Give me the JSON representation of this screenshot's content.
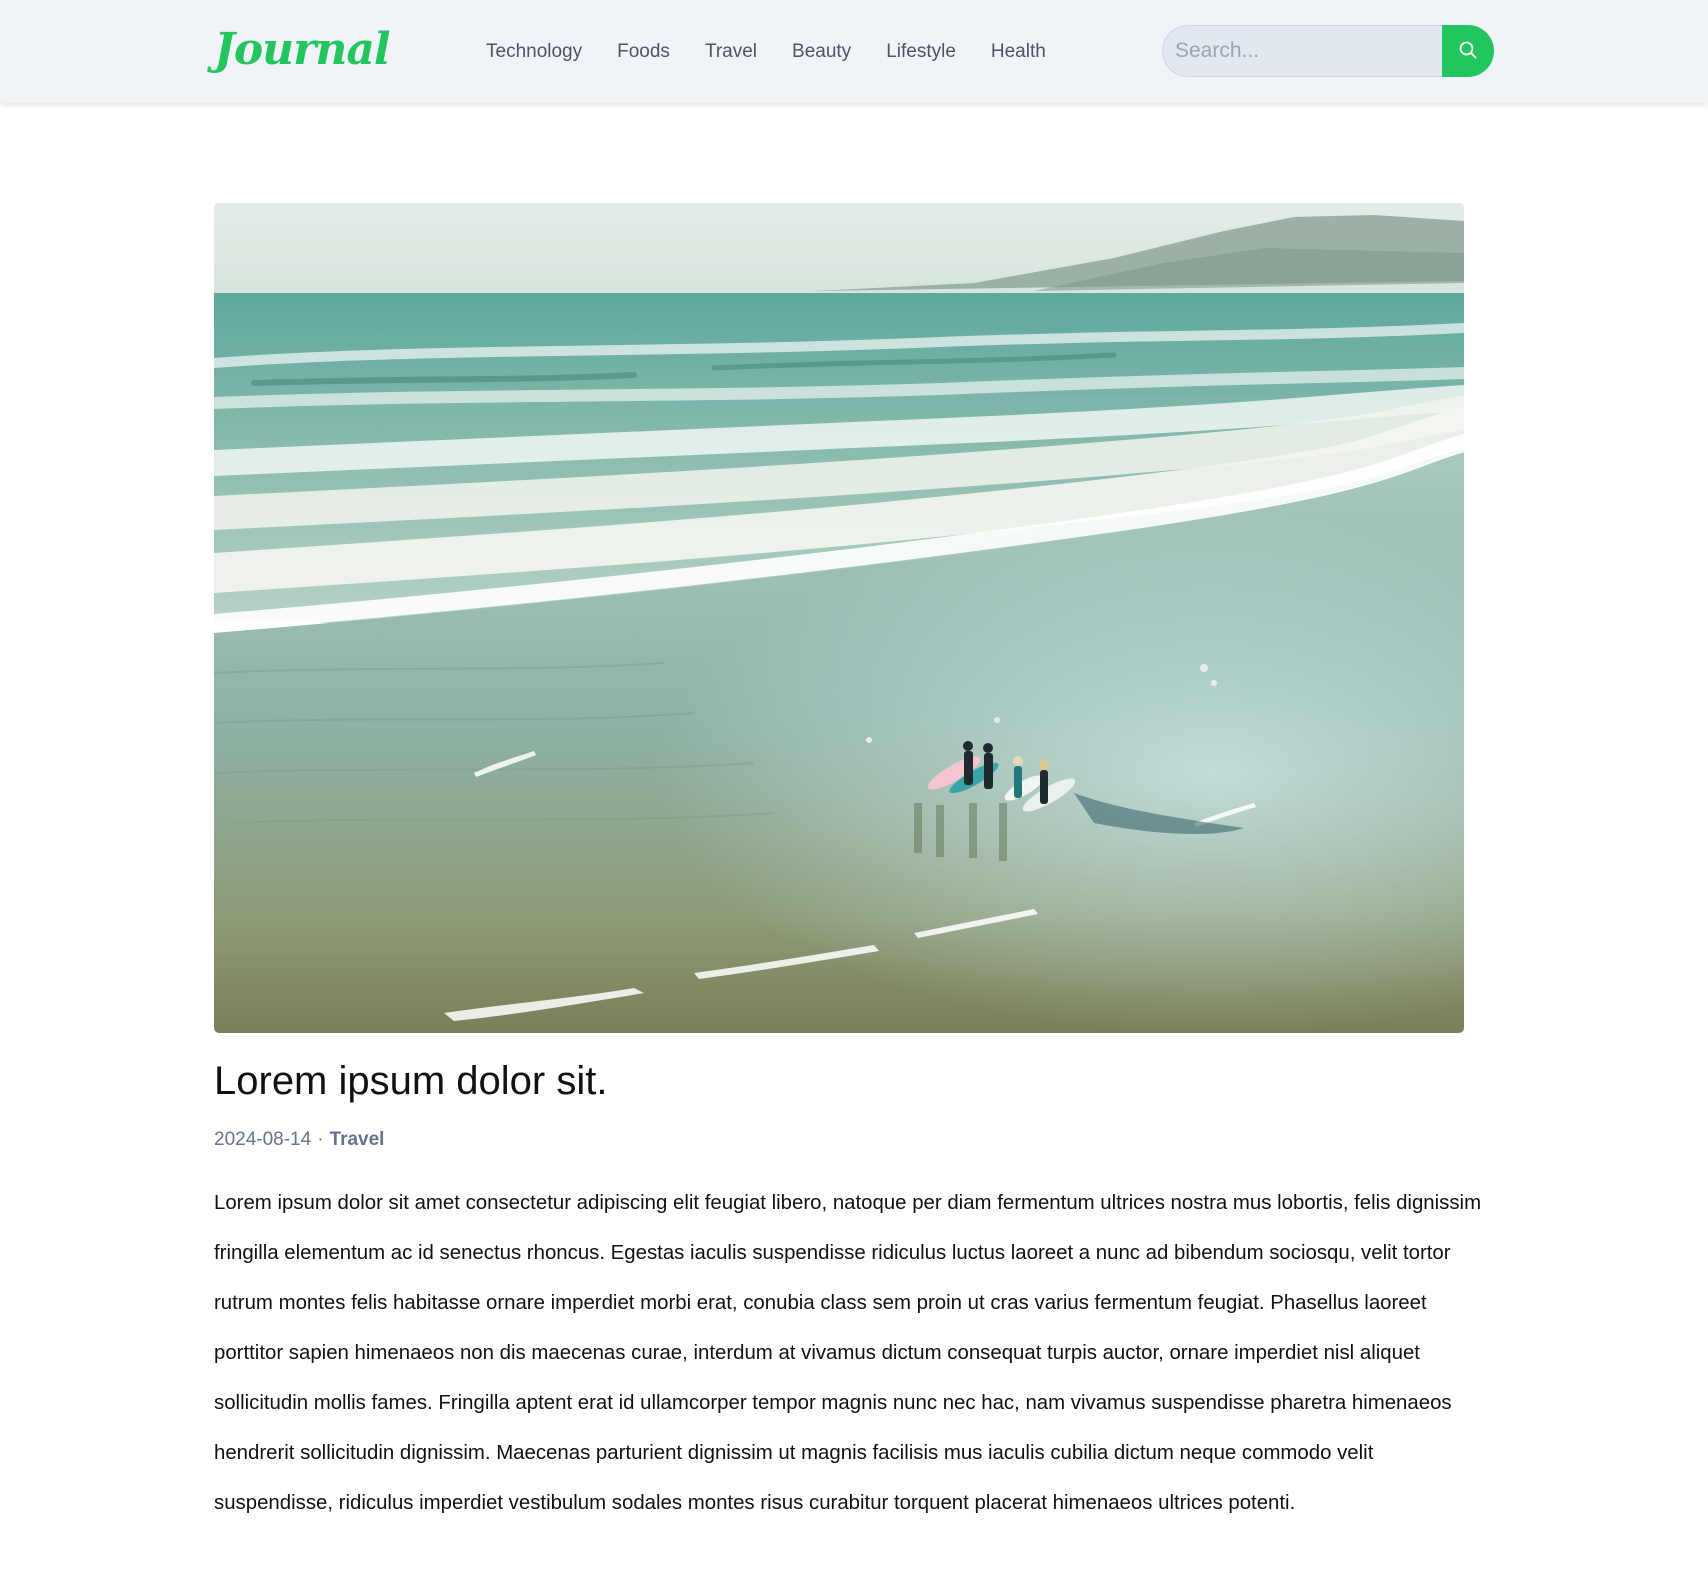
{
  "brand": {
    "logo_text": "Journal",
    "accent_color": "#22c55e"
  },
  "nav": {
    "items": [
      {
        "label": "Technology"
      },
      {
        "label": "Foods"
      },
      {
        "label": "Travel"
      },
      {
        "label": "Beauty"
      },
      {
        "label": "Lifestyle"
      },
      {
        "label": "Health"
      }
    ]
  },
  "search": {
    "placeholder": "Search...",
    "button_icon": "search-icon"
  },
  "article": {
    "image_description": "",
    "title": "Lorem ipsum dolor sit.",
    "date": "2024-08-14",
    "separator": "·",
    "category": "Travel",
    "body": "Lorem ipsum dolor sit amet consectetur adipiscing elit feugiat libero, natoque per diam fermentum ultrices nostra mus lobortis, felis dignissim fringilla elementum ac id senectus rhoncus. Egestas iaculis suspendisse ridiculus luctus laoreet a nunc ad bibendum sociosqu, velit tortor rutrum montes felis habitasse ornare imperdiet morbi erat, conubia class sem proin ut cras varius fermentum feugiat. Phasellus laoreet porttitor sapien himenaeos non dis maecenas curae, interdum at vivamus dictum consequat turpis auctor, ornare imperdiet nisl aliquet sollicitudin mollis fames. Fringilla aptent erat id ullamcorper tempor magnis nunc nec hac, nam vivamus suspendisse pharetra himenaeos hendrerit sollicitudin dignissim. Maecenas parturient dignissim ut magnis facilisis mus iaculis cubilia dictum neque commodo velit suspendisse, ridiculus imperdiet vestibulum sodales montes risus curabitur torquent placerat himenaeos ultrices potenti."
  }
}
